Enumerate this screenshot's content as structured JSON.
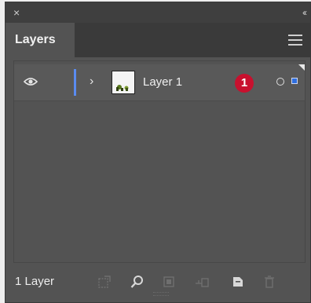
{
  "panel": {
    "close_glyph": "×",
    "collapse_glyph": "‹‹",
    "tab_title": "Layers",
    "menu_icon": "menu-icon"
  },
  "layers": [
    {
      "name": "Layer 1",
      "color": "#5a8bf0",
      "visible": true,
      "expanded": false,
      "selected": true
    }
  ],
  "callout": {
    "label": "1",
    "color": "#c8102e"
  },
  "footer": {
    "count_label": "1 Layer",
    "icons": [
      "export-icon",
      "locate-object-icon",
      "make-clipping-mask-icon",
      "create-sublayer-icon",
      "create-new-layer-icon",
      "delete-icon"
    ]
  },
  "colors": {
    "panel_bg": "#535353",
    "topbar_bg": "#3f3f3f",
    "tabrow_bg": "#3a3a3a",
    "row_bg": "#595959"
  }
}
